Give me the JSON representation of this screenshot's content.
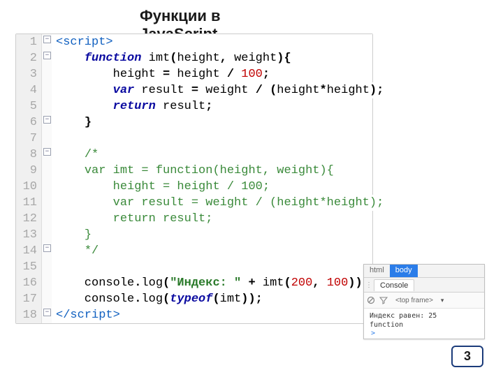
{
  "title_line1": "Функции в",
  "title_line2": "JavaScript",
  "code": {
    "lines": [
      {
        "n": "1",
        "fold": "-",
        "html": "<span class='tag'>&lt;script&gt;</span>"
      },
      {
        "n": "2",
        "fold": "-",
        "html": "    <span class='kw'>function</span> <span class='ident'>imt</span><span class='bold'>(</span>height<span class='bold'>,</span> weight<span class='bold'>){</span>"
      },
      {
        "n": "3",
        "fold": "",
        "html": "        height <span class='op'>=</span> height <span class='op'>/</span> <span class='num'>100</span><span class='bold'>;</span>"
      },
      {
        "n": "4",
        "fold": "",
        "html": "        <span class='kw'>var</span> result <span class='op'>=</span> weight <span class='op'>/</span> <span class='bold'>(</span>height<span class='op'>*</span>height<span class='bold'>);</span>"
      },
      {
        "n": "5",
        "fold": "",
        "html": "        <span class='kw'>return</span> result<span class='bold'>;</span>"
      },
      {
        "n": "6",
        "fold": "-",
        "html": "    <span class='bold'>}</span>"
      },
      {
        "n": "7",
        "fold": "",
        "html": ""
      },
      {
        "n": "8",
        "fold": "-",
        "html": "    <span class='cmt'>/*</span>"
      },
      {
        "n": "9",
        "fold": "",
        "html": "    <span class='cmt'>var imt = function(height, weight){</span>"
      },
      {
        "n": "10",
        "fold": "",
        "html": "    <span class='cmt'>    height = height / 100;</span>"
      },
      {
        "n": "11",
        "fold": "",
        "html": "    <span class='cmt'>    var result = weight / (height*height);</span>"
      },
      {
        "n": "12",
        "fold": "",
        "html": "    <span class='cmt'>    return result;</span>"
      },
      {
        "n": "13",
        "fold": "",
        "html": "    <span class='cmt'>}</span>"
      },
      {
        "n": "14",
        "fold": "-",
        "html": "    <span class='cmt'>*/</span>"
      },
      {
        "n": "15",
        "fold": "",
        "html": ""
      },
      {
        "n": "16",
        "fold": "",
        "html": "    console<span class='bold'>.</span>log<span class='bold'>(</span><span class='str'>\"Индекс: \"</span> <span class='op'>+</span> imt<span class='bold'>(</span><span class='num'>200</span><span class='bold'>,</span> <span class='num'>100</span><span class='bold'>));</span>"
      },
      {
        "n": "17",
        "fold": "",
        "html": "    console<span class='bold'>.</span>log<span class='bold'>(</span><span class='kw'>typeof</span><span class='bold'>(</span>imt<span class='bold'>));</span>"
      },
      {
        "n": "18",
        "fold": "-",
        "html": "<span class='tag'>&lt;/script&gt;</span>"
      }
    ]
  },
  "devtools": {
    "breadcrumb": [
      "html",
      "body"
    ],
    "active_bc": 1,
    "tabs": [
      "Console"
    ],
    "frame_selector": "<top frame>",
    "frame_caret": "▾",
    "console_lines": [
      "Индекс равен:  25",
      "function"
    ],
    "prompt": ">"
  },
  "page_number": "3"
}
